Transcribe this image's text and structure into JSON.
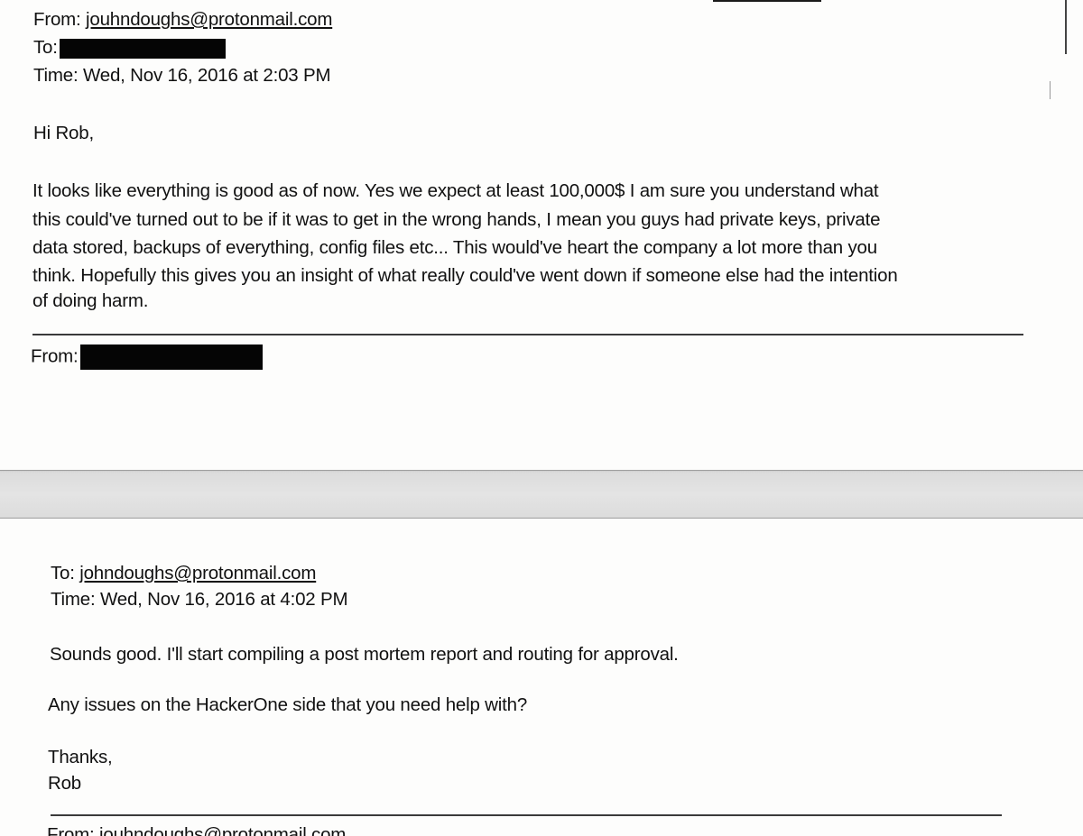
{
  "email_1": {
    "from_label": "From:",
    "from_address": "jouhndoughs@protonmail.com",
    "to_label": "To:",
    "time_line": "Time: Wed, Nov 16, 2016 at 2:03 PM",
    "greeting": "Hi Rob,",
    "body_lines": [
      "It looks like everything is good as of now. Yes we expect at least 100,000$ I am sure you understand what",
      "this could've turned out to be if it was to get in the wrong hands, I mean you guys had private keys, private",
      "data stored, backups of everything, config files etc... This would've heart the company a lot more than you",
      "think. Hopefully this gives you an insight of what really could've went down if someone else had the intention",
      "of doing harm."
    ],
    "quoted_from_label": "From:"
  },
  "email_2": {
    "to_label": "To:",
    "to_address": "johndoughs@protonmail.com",
    "time_line": "Time: Wed, Nov 16, 2016 at 4:02 PM",
    "body_lines": [
      "Sounds good.  I'll start compiling a post mortem report and routing for approval.",
      "Any issues on the HackerOne side that you need help with?"
    ],
    "signoff": "Thanks,",
    "signature": "Rob",
    "quoted_from_partial": "From: jouhndoughs@protonmail.com"
  }
}
